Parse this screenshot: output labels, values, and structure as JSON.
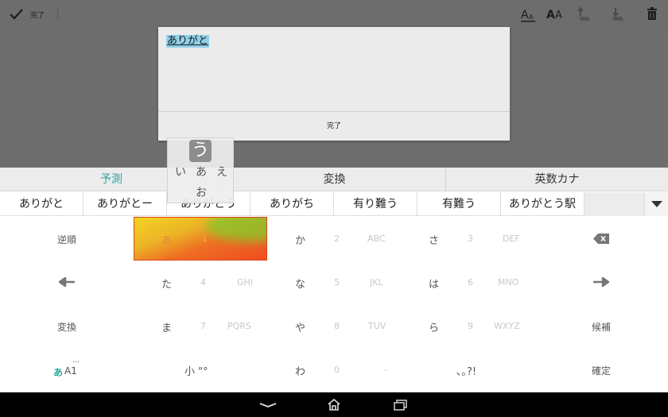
{
  "actionbar": {
    "done_label": "完了",
    "tools": [
      "font-size-small-icon",
      "font-size-large-icon",
      "move-up-icon",
      "move-down-icon",
      "delete-icon"
    ]
  },
  "dialog": {
    "text": "ありがと",
    "button_label": "完了"
  },
  "keyboard": {
    "mode_tabs": [
      "予測",
      "変換",
      "英数カナ"
    ],
    "active_tab": "予測",
    "candidates": [
      "ありがと",
      "ありがとー",
      "ありがとう",
      "ありがち",
      "有り難う",
      "有難う",
      "ありがとう駅"
    ],
    "keys": {
      "reverse": "逆順",
      "a": {
        "main": "あ",
        "sub": "1",
        "sub2": "@#/&_"
      },
      "ka": {
        "main": "か",
        "sub": "2",
        "sub2": "ABC"
      },
      "sa": {
        "main": "さ",
        "sub": "3",
        "sub2": "DEF"
      },
      "ta": {
        "main": "た",
        "sub": "4",
        "sub2": "GHI"
      },
      "na": {
        "main": "な",
        "sub": "5",
        "sub2": "JKL"
      },
      "ha": {
        "main": "は",
        "sub": "6",
        "sub2": "MNO"
      },
      "ma": {
        "main": "ま",
        "sub": "7",
        "sub2": "PQRS"
      },
      "ya": {
        "main": "や",
        "sub": "8",
        "sub2": "TUV"
      },
      "ra": {
        "main": "ら",
        "sub": "9",
        "sub2": "WXYZ"
      },
      "convert": "変換",
      "candidates": "候補",
      "mode_kana": "あ",
      "mode_num": "A1",
      "mode_dots": "…",
      "small": "小 \"°",
      "wa": {
        "main": "わ",
        "sub": "0",
        "sub2": "-"
      },
      "punct": "､｡?!",
      "confirm": "確定"
    },
    "flick": {
      "center": "あ",
      "up": "う",
      "left": "い",
      "right": "え",
      "down": "お"
    }
  },
  "colors": {
    "accent": "#2aa69e",
    "flick_key": "#ef5b22"
  }
}
